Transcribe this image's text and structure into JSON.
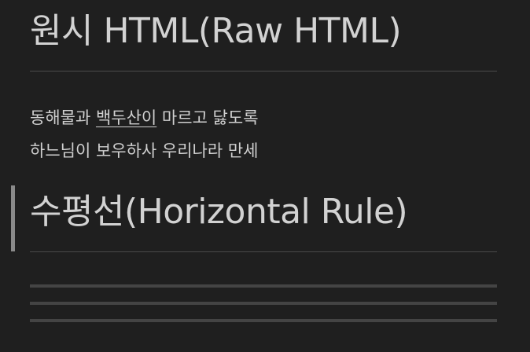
{
  "colors": {
    "background": "#1f1f1f",
    "text": "#d2d2d2",
    "rule": "#4a4a4a",
    "hr": "#444444",
    "cursor": "#8a8a8a"
  },
  "heading_raw_html": "원시 HTML(Raw HTML)",
  "paragraph": {
    "line1_before": "동해물과 ",
    "line1_underlined": "백두산이",
    "line1_after": " 마르고 닳도록",
    "line2": "하느님이 보우하사 우리나라 만세"
  },
  "heading_horizontal_rule": "수평선(Horizontal Rule)"
}
